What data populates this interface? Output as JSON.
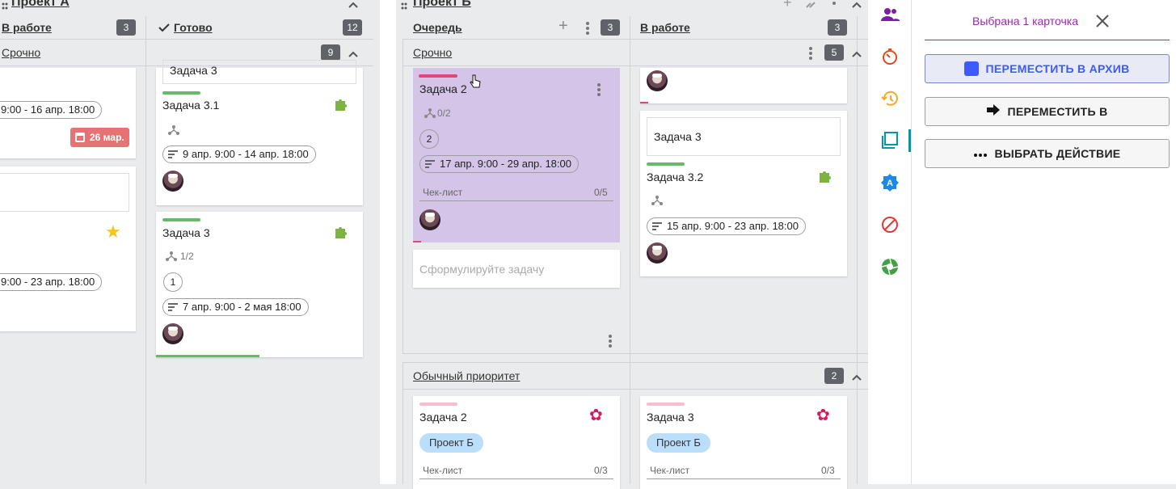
{
  "left_board": {
    "title": "Проект А",
    "col1": {
      "title": "В работе",
      "count": "3"
    },
    "col2": {
      "title": "Готово",
      "count": "12"
    },
    "swimlane": {
      "title": "Срочно",
      "count": "9"
    },
    "col1_cards": {
      "date1": "9:00 - 16 апр. 18:00",
      "due": "26 мар.",
      "date2": "9:00 - 23 апр. 18:00"
    },
    "col2_cards": [
      {
        "parent": "Задача 3"
      },
      {
        "title": "Задача 3.1",
        "dates": "9 апр. 9:00 - 14 апр. 18:00"
      },
      {
        "title": "Задача 3",
        "subtasks": "1/2",
        "count": "1",
        "dates": "7 апр. 9:00 - 2 мая 18:00"
      }
    ]
  },
  "right_board": {
    "title": "Проект Б",
    "col1": {
      "title": "Очередь",
      "count": "3"
    },
    "col2": {
      "title": "В работе",
      "count": "3"
    },
    "urgent": {
      "title": "Срочно",
      "count": "5"
    },
    "selected_card": {
      "title": "Задача 2",
      "subtasks": "0/2",
      "count": "2",
      "dates": "17 апр. 9:00 - 29 апр. 18:00",
      "checklist": "Чек-лист",
      "progress": "0/5"
    },
    "new_task_placeholder": "Сформулируйте задачу",
    "work_cards": {
      "parent": "Задача 3",
      "title": "Задача 3.2",
      "dates": "15 апр. 9:00 - 23 апр. 18:00"
    },
    "normal": {
      "title": "Обычный приоритет",
      "count": "2"
    },
    "normal_cards": [
      {
        "title": "Задача 2",
        "tag": "Проект Б",
        "checklist": "Чек-лист",
        "progress": "0/3"
      },
      {
        "title": "Задача 3",
        "tag": "Проект Б",
        "checklist": "Чек-лист",
        "progress": "0/3"
      }
    ]
  },
  "sidebar": {
    "icons": [
      "people-icon",
      "timer-icon",
      "history-icon",
      "cards-icon",
      "auto-icon",
      "block-icon",
      "aperture-icon"
    ]
  },
  "panel": {
    "selected_text": "Выбрана 1 карточка",
    "archive": "ПЕРЕМЕСТИТЬ В АРХИВ",
    "move_to": "ПЕРЕМЕСТИТЬ В",
    "choose_action": "ВЫБРАТЬ ДЕЙСТВИЕ"
  },
  "colors": {
    "accent": "#9c27b0",
    "blue": "#3d5afe",
    "selected_card": "#d3c4e8",
    "urgent_bar": "#e0467c",
    "green_bar": "#66bb6a",
    "normal_bar": "#f8bbd0",
    "tag": "#bbdefb",
    "due_badge": "#e57373"
  }
}
